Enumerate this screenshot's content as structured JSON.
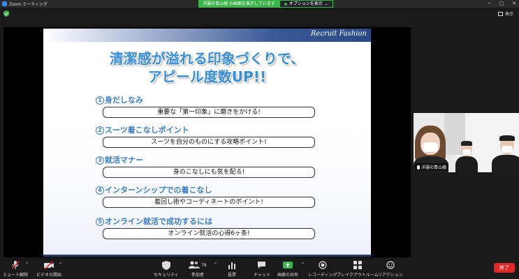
{
  "titlebar": {
    "app_title": "Zoom ミーティング",
    "share_status": "洋服の青山様 の画面を表示しています",
    "options_label": "オプションを表示",
    "options_caret": "⌄",
    "minimize": "─",
    "maximize": "□",
    "close": "✕"
  },
  "topbar": {
    "view_label": "表示"
  },
  "slide": {
    "brand": "Recruit Fashion",
    "title_line1": "清潔感が溢れる印象づくりで、",
    "title_line2": "アピール度数UP!!",
    "items": [
      {
        "num": "1",
        "heading": "身だしなみ",
        "desc": "重要な「第一印象」に磨きをかける!"
      },
      {
        "num": "2",
        "heading": "スーツ着こなしポイント",
        "desc": "スーツを自分のものにする攻略ポイント!"
      },
      {
        "num": "3",
        "heading": "就活マナー",
        "desc": "身のこなしにも気を配る!"
      },
      {
        "num": "4",
        "heading": "インターンシップでの着こなし",
        "desc": "着回し術やコーディネートのポイント!"
      },
      {
        "num": "5",
        "heading": "オンライン就活で成功するには",
        "desc": "オンライン就活の心得6ヶ条!"
      }
    ]
  },
  "participant": {
    "name": "洋服の青山様"
  },
  "toolbar": {
    "unmute": "ミュート解除",
    "start_video": "ビデオの開始",
    "security": "セキュリティ",
    "participants": "参加者",
    "participants_count": "78",
    "polls": "投票",
    "chat": "チャット",
    "share_screen": "画面の共有",
    "recording": "レコーディング",
    "breakout": "ブレイクアウトルーム",
    "reactions": "リアクション",
    "end": "終了",
    "caret": "^"
  },
  "colors": {
    "accent_green": "#3bb54a",
    "end_red": "#e02828",
    "slide_heading_blue": "#3c7fc0",
    "slide_title_blue": "#3a8fd4"
  }
}
